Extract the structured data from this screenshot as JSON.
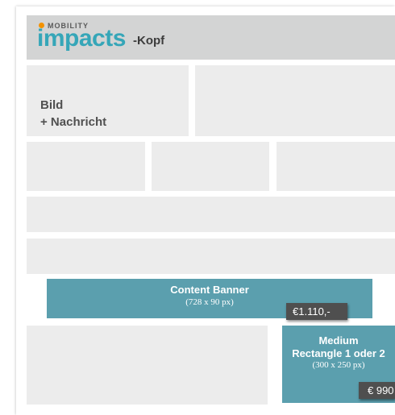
{
  "header": {
    "logo_top": "MOBILITY",
    "logo_main": "impacts",
    "suffix": "-Kopf"
  },
  "bild": {
    "line1": "Bild",
    "line2": "+ Nachricht"
  },
  "content_banner": {
    "title": "Content Banner",
    "size": "(728 x 90 px)",
    "price": "€1.110,-"
  },
  "medium_rectangle": {
    "line1": "Medium",
    "line2": "Rectangle 1 oder 2",
    "size": "(300 x 250 px)",
    "price": "€ 990"
  },
  "colors": {
    "accent_teal": "#5b9fae",
    "logo_teal": "#35a6b8",
    "logo_orange": "#f39200",
    "placeholder_gray": "#ececec",
    "header_gray": "#d3d4d4",
    "price_tag": "#4f4f4f"
  }
}
